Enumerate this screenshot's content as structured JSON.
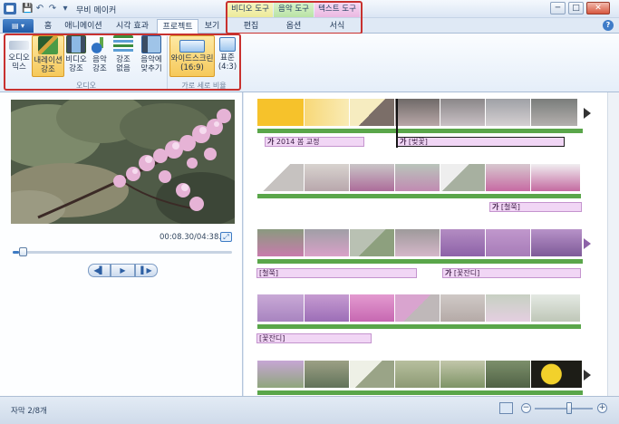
{
  "titlebar": {
    "title": "무비 메이커",
    "minimize": "─",
    "maximize": "□",
    "close": "✕"
  },
  "quick_access": {
    "save": "💾",
    "undo": "↶",
    "redo": "↷",
    "dropdown": "▾"
  },
  "contextual_tabs": {
    "video_tools": "비디오 도구",
    "music_tools": "음악 도구",
    "text_tools": "텍스트 도구",
    "edit": "편집",
    "options": "옵션",
    "format": "서식"
  },
  "tabs": [
    "홈",
    "애니메이션",
    "시각 효과",
    "프로젝트",
    "보기"
  ],
  "active_tab": "프로젝트",
  "file_menu": "▤ ▾",
  "help": "?",
  "ribbon": {
    "audio_group": {
      "label": "오디오",
      "buttons": [
        {
          "line1": "오디오",
          "line2": "믹스"
        },
        {
          "line1": "내레이션",
          "line2": "강조"
        },
        {
          "line1": "비디오",
          "line2": "강조"
        },
        {
          "line1": "음악",
          "line2": "강조"
        },
        {
          "line1": "강조",
          "line2": "없음"
        },
        {
          "line1": "음악에",
          "line2": "맞추기"
        }
      ]
    },
    "aspect_group": {
      "label": "가로 세로 비율",
      "buttons": [
        {
          "line1": "와이드스크린",
          "line2": "(16:9)"
        },
        {
          "line1": "표준",
          "line2": "(4:3)"
        }
      ]
    }
  },
  "preview": {
    "time": "00:08.30/04:38.00",
    "fullscreen": "⤢",
    "progress": 0.03,
    "prev": "◀▌",
    "play": "▶",
    "next": "▌▶"
  },
  "storyboard": {
    "rows": [
      {
        "captions": [
          {
            "text": "2014 봄 교정",
            "glyph": "가"
          },
          {
            "text": "[벚꽃]",
            "glyph": "가",
            "dark": true
          }
        ]
      },
      {
        "captions": [
          {
            "text": "[철쭉]",
            "glyph": "가"
          }
        ]
      },
      {
        "captions": [
          {
            "text": "[철쭉]",
            "glyph": ""
          },
          {
            "text": "[꽃잔디]",
            "glyph": "가"
          }
        ]
      },
      {
        "captions": [
          {
            "text": "[꽃잔디]",
            "glyph": ""
          }
        ]
      },
      {
        "captions": []
      }
    ]
  },
  "status": {
    "caption_count": "자막 2/8개",
    "zoom_out": "−",
    "zoom_in": "+",
    "zoom_level": 0.6
  },
  "colors": {
    "accent": "#3d7bc4",
    "highlight": "#c8312f",
    "caption_bg": "#f1d6f5",
    "audio_bar": "#5aa64a"
  }
}
